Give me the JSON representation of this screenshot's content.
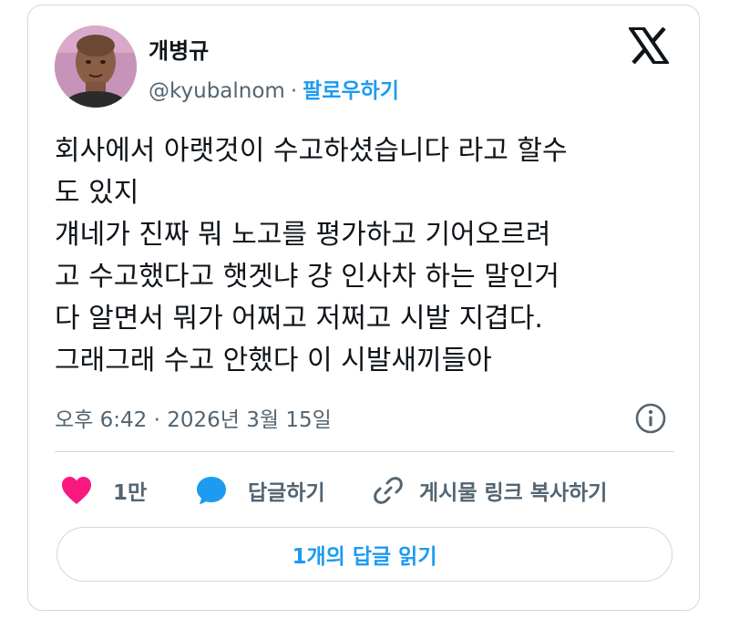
{
  "author": {
    "display_name": "개병규",
    "handle": "@kyubalnom",
    "separator": "·",
    "follow_label": "팔로우하기"
  },
  "tweet": {
    "lines": [
      "회사에서 아랫것이 수고하셨습니다 라고 할수",
      "도 있지",
      "걔네가 진짜 뭐 노고를 평가하고 기어오르려",
      "고 수고했다고 햇겟냐 걍 인사차 하는 말인거",
      "다 알면서 뭐가 어쩌고 저쩌고 시발 지겹다.",
      "그래그래 수고 안했다 이 시발새끼들아"
    ],
    "timestamp": "오후 6:42 · 2026년 3월 15일"
  },
  "actions": {
    "like_count": "1만",
    "reply_label": "답글하기",
    "copy_link_label": "게시물 링크 복사하기",
    "read_replies_label": "1개의 답글 읽기"
  },
  "icons": {
    "logo": "x-logo-icon",
    "info": "info-icon",
    "like": "heart-icon",
    "reply": "speech-bubble-icon",
    "link": "link-icon"
  },
  "colors": {
    "text": "#0f1419",
    "secondary": "#536471",
    "accent": "#1d9bf0",
    "like": "#f91880",
    "border": "#cfd9de"
  }
}
